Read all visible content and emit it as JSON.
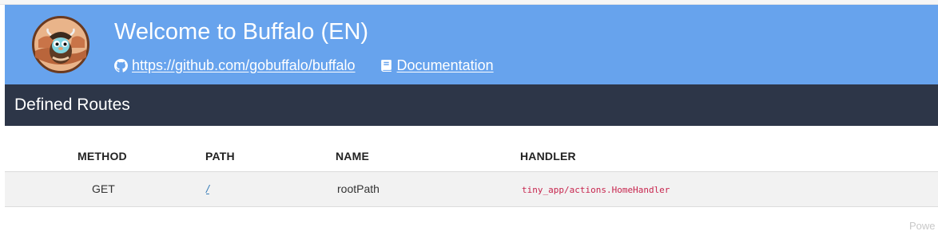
{
  "header": {
    "title": "Welcome to Buffalo (EN)",
    "github_link": "https://github.com/gobuffalo/buffalo",
    "docs_link": "Documentation",
    "background_color": "#67a3ed"
  },
  "routes_section": {
    "title": "Defined Routes",
    "background_color": "#2d3648"
  },
  "routes_table": {
    "columns": [
      "METHOD",
      "PATH",
      "NAME",
      "HANDLER"
    ],
    "rows": [
      {
        "method": "GET",
        "path": "/",
        "name": "rootPath",
        "handler": "tiny_app/actions.HomeHandler"
      }
    ]
  },
  "footer": {
    "text": "Powe"
  },
  "icons": {
    "logo": "buffalo-gopher-logo",
    "github": "github-icon",
    "docs": "book-icon"
  }
}
